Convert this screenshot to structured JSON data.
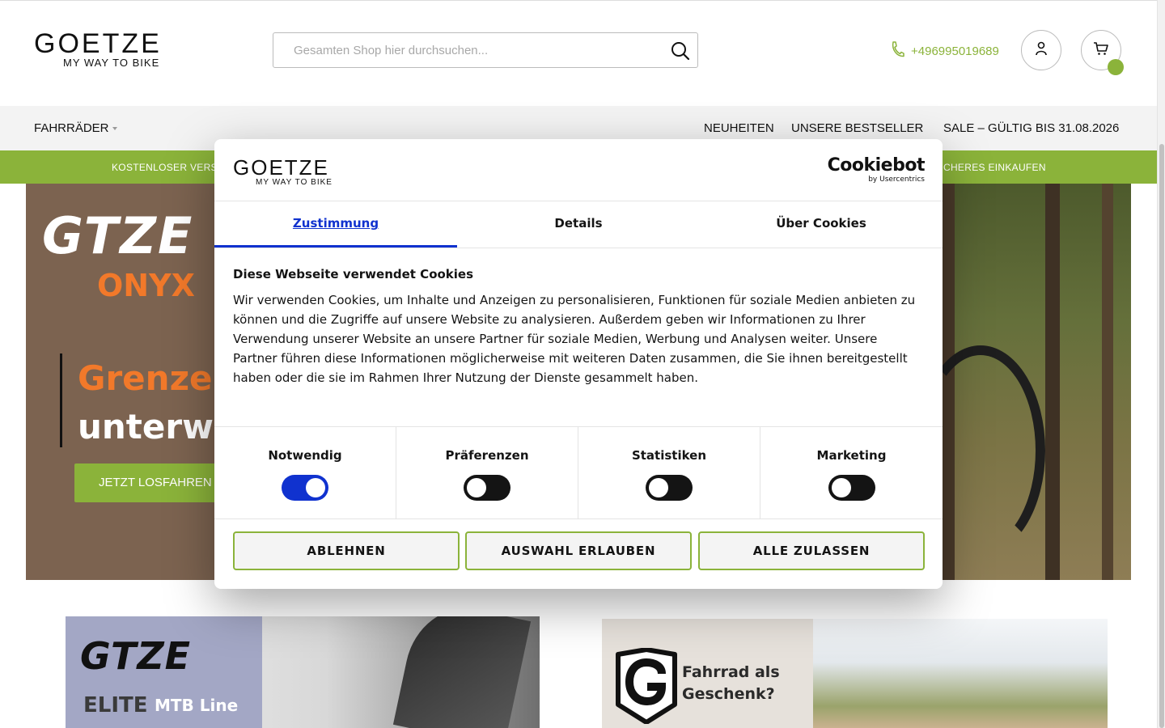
{
  "header": {
    "logo_word": "GOETZE",
    "logo_tagline": "MY WAY TO BIKE",
    "search_placeholder": "Gesamten Shop hier durchsuchen...",
    "phone": "+496995019689",
    "account_icon": "user-icon",
    "cart_icon": "cart-icon"
  },
  "nav": {
    "fahrraeder": "FAHRRÄDER",
    "neuheiten": "NEUHEITEN",
    "bestseller": "UNSERE BESTSELLER",
    "sale": "SALE – GÜLTIG BIS 31.08.2026"
  },
  "usp": {
    "left": "KOSTENLOSER VERS",
    "right": "CHERES EINKAUFEN"
  },
  "hero": {
    "brand": "GTZE",
    "model": "ONYX",
    "line1": "Grenzen",
    "line2": "unterwe",
    "cta": "JETZT LOSFAHREN"
  },
  "promos": {
    "promo1_brand": "GTZE",
    "promo1_elite": "ELITE",
    "promo1_line": "MTB Line",
    "promo2_line1": "Fahrrad als",
    "promo2_line2": "Geschenk?"
  },
  "cookie_dialog": {
    "logo_word": "GOETZE",
    "logo_tagline": "MY WAY TO BIKE",
    "provider_name": "Cookiebot",
    "provider_by": "by Usercentrics",
    "tabs": [
      {
        "label": "Zustimmung",
        "active": true
      },
      {
        "label": "Details",
        "active": false
      },
      {
        "label": "Über Cookies",
        "active": false
      }
    ],
    "title": "Diese Webseite verwendet Cookies",
    "text": "Wir verwenden Cookies, um Inhalte und Anzeigen zu personalisieren, Funktionen für soziale Medien anbieten zu können und die Zugriffe auf unsere Website zu analysieren. Außerdem geben wir Informationen zu Ihrer Verwendung unserer Website an unsere Partner für soziale Medien, Werbung und Analysen weiter. Unsere Partner führen diese Informationen möglicherweise mit weiteren Daten zusammen, die Sie ihnen bereitgestellt haben oder die sie im Rahmen Ihrer Nutzung der Dienste gesammelt haben.",
    "categories": [
      {
        "label": "Notwendig",
        "enabled": true
      },
      {
        "label": "Präferenzen",
        "enabled": false
      },
      {
        "label": "Statistiken",
        "enabled": false
      },
      {
        "label": "Marketing",
        "enabled": false
      }
    ],
    "buttons": {
      "reject": "ABLEHNEN",
      "allow_selection": "AUSWAHL ERLAUBEN",
      "allow_all": "ALLE ZULASSEN"
    }
  },
  "colors": {
    "accent_green": "#8bb33a",
    "active_blue": "#1032cf",
    "hero_orange": "#f2792a"
  }
}
